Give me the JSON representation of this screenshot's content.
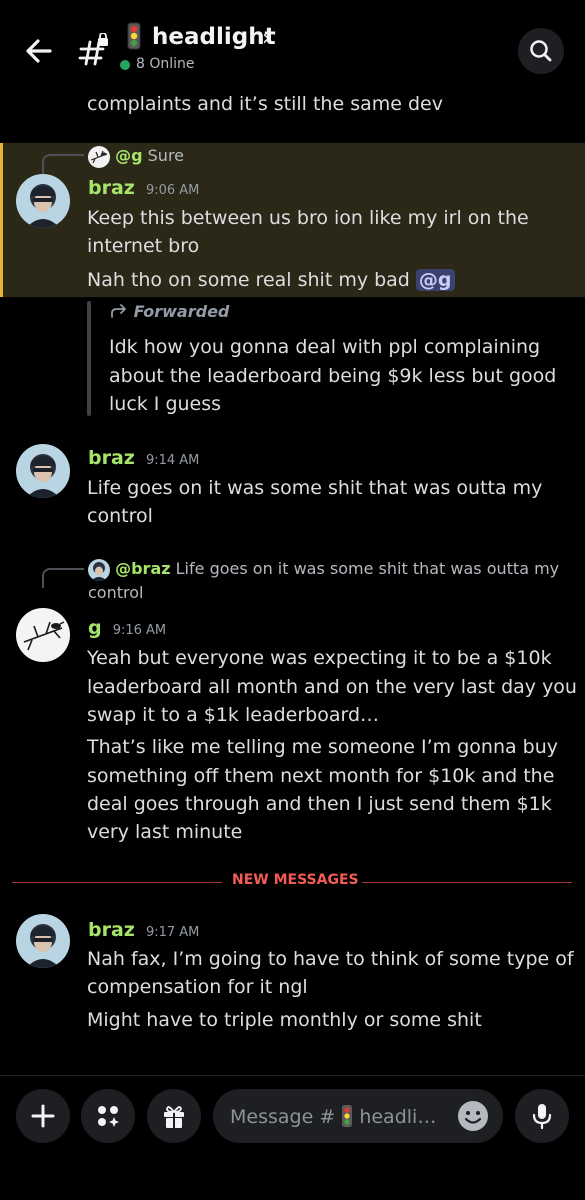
{
  "header": {
    "channel_name": "headlight",
    "online_count": "8 Online"
  },
  "messages": {
    "clipped_text": "complaints and it’s still the same dev",
    "reply1": {
      "mention": "@g",
      "text": "Sure"
    },
    "msg1": {
      "username": "braz",
      "time": "9:06 AM",
      "line1": "Keep this between us bro ion like my irl on the",
      "line2": "internet bro",
      "line3": "Nah tho on some real shit my bad",
      "mention": "@g"
    },
    "forward": {
      "label": "Forwarded",
      "line1": "Idk how you gonna deal with ppl complaining",
      "line2": "about the leaderboard being $9k less but good",
      "line3": "luck I guess"
    },
    "msg2": {
      "username": "braz",
      "time": "9:14 AM",
      "line1": "Life goes on it was some shit that was outta my",
      "line2": "control"
    },
    "reply2": {
      "mention": "@braz",
      "text": "Life goes on it was some shit that was outta my",
      "text2": "control"
    },
    "msg3": {
      "username": "g",
      "time": "9:16 AM",
      "line1": "Yeah but everyone was expecting it to be a $10k",
      "line2": "leaderboard all month and on the very last day you",
      "line3": "swap it to a $1k leaderboard…",
      "line4": "That’s like me telling me someone I’m gonna buy",
      "line5": "something off them next month for $10k and the",
      "line6": "deal goes through and then I just send them $1k",
      "line7": "very last minute"
    },
    "new_messages_label": "NEW MESSAGES",
    "msg4": {
      "username": "braz",
      "time": "9:17 AM",
      "line1": "Nah fax, I’m going to have to think of some type of",
      "line2": "compensation for it ngl",
      "line3": "Might have to triple monthly or some shit"
    }
  },
  "composer": {
    "placeholder_prefix": "Message #",
    "placeholder_suffix": "headli…"
  },
  "colors": {
    "background": "#000000",
    "username_green": "#a6e36a",
    "highlight_bg": "#2c2817",
    "highlight_bar": "#e7b33a",
    "new_messages_red": "#f25c54",
    "mention_bg": "#3c4270",
    "online_green": "#23a55a"
  }
}
